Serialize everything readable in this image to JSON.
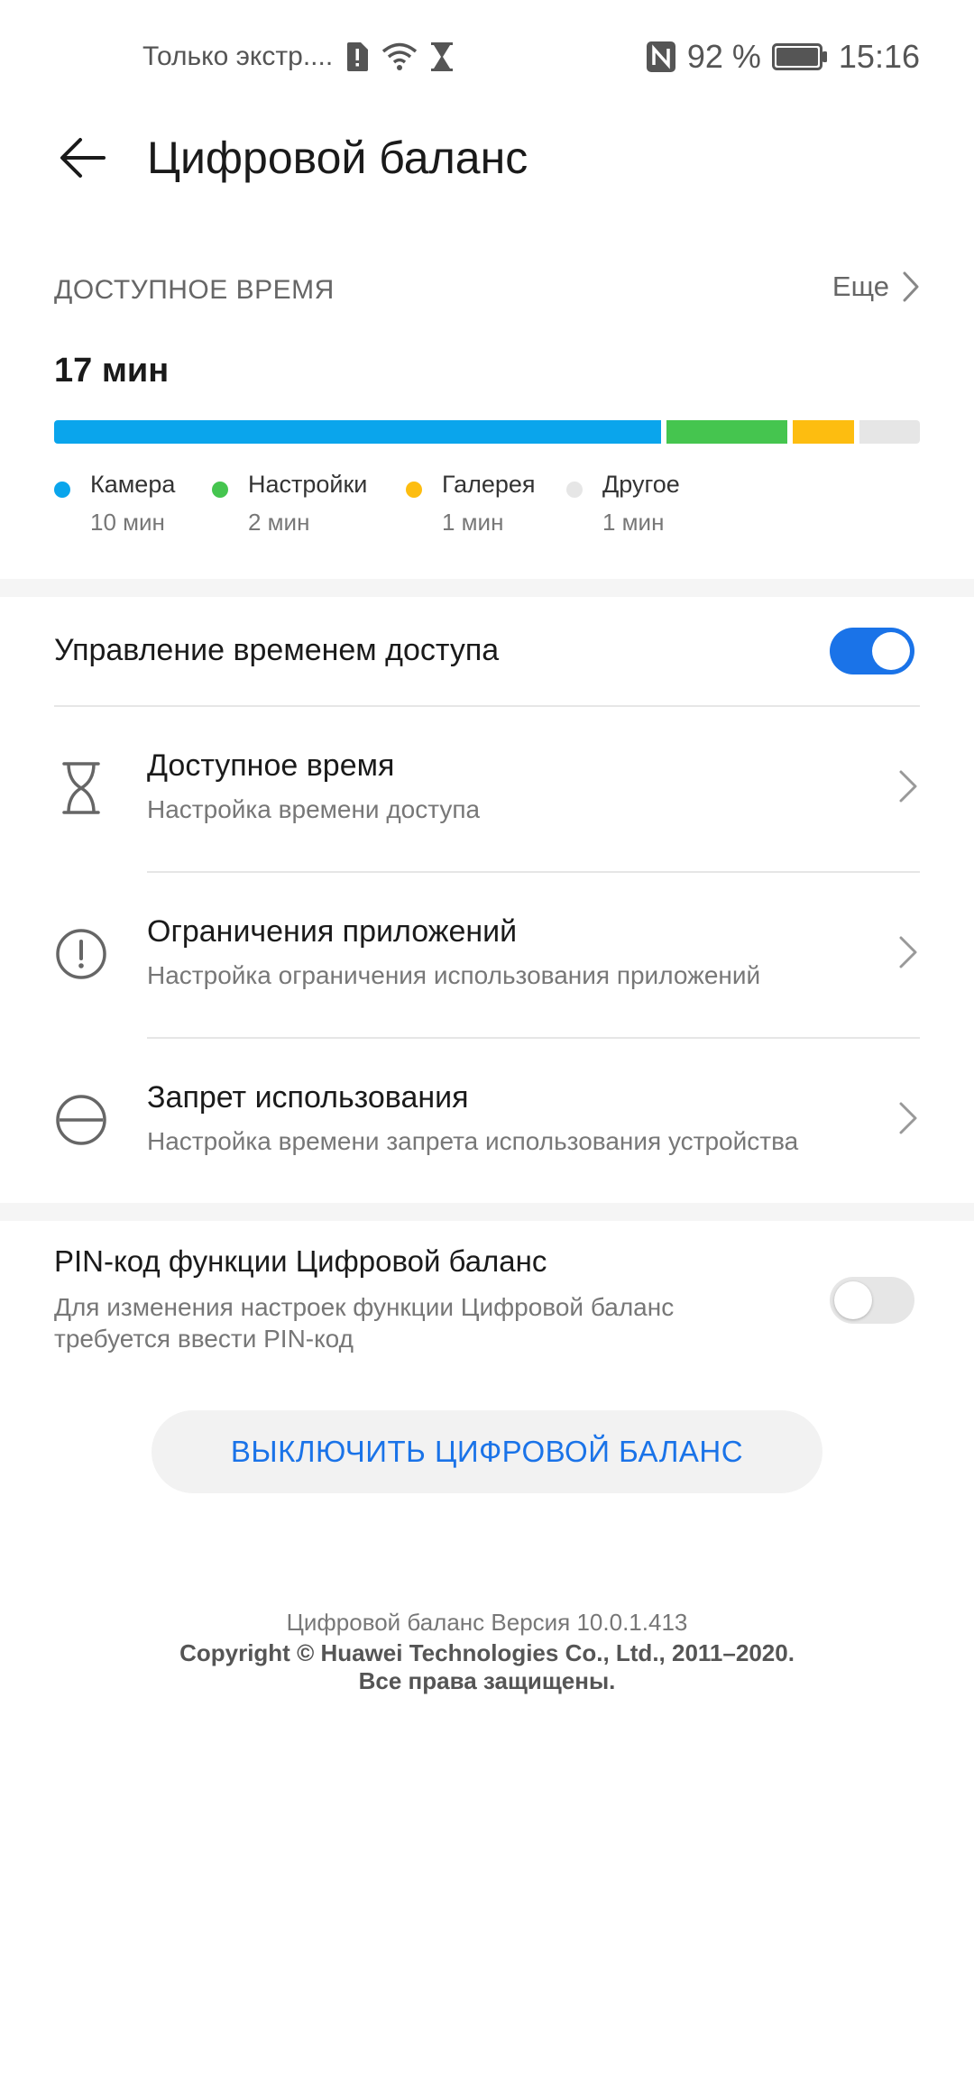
{
  "status_bar": {
    "carrier_text": "Только экстр....",
    "battery_percent": "92 %",
    "time": "15:16",
    "icons": [
      "sim-alert-icon",
      "wifi-icon",
      "hourglass-icon",
      "nfc-icon",
      "battery-icon"
    ]
  },
  "header": {
    "title": "Цифровой баланс"
  },
  "usage": {
    "section_label": "ДОСТУПНОЕ ВРЕМЯ",
    "more_label": "Еще",
    "total": "17 мин",
    "apps": [
      {
        "name": "Камера",
        "time": "10 мин",
        "minutes": 10,
        "color": "#0aa5ec"
      },
      {
        "name": "Настройки",
        "time": "2 мин",
        "minutes": 2,
        "color": "#45c54f"
      },
      {
        "name": "Галерея",
        "time": "1 мин",
        "minutes": 1,
        "color": "#fdbd10"
      },
      {
        "name": "Другое",
        "time": "1 мин",
        "minutes": 1,
        "color": "#e6e6e6"
      }
    ]
  },
  "access_control": {
    "label": "Управление временем доступа",
    "enabled": true
  },
  "menu": [
    {
      "icon": "hourglass-icon",
      "title": "Доступное время",
      "subtitle": "Настройка времени доступа"
    },
    {
      "icon": "alert-circle-icon",
      "title": "Ограничения приложений",
      "subtitle": "Настройка ограничения использования приложений"
    },
    {
      "icon": "minus-circle-icon",
      "title": "Запрет использования",
      "subtitle": "Настройка времени запрета использования устройства"
    }
  ],
  "pin": {
    "title": "PIN-код функции Цифровой баланс",
    "subtitle": "Для изменения настроек функции Цифровой баланс требуется ввести PIN-код",
    "enabled": false
  },
  "disable_button": {
    "label": "ВЫКЛЮЧИТЬ ЦИФРОВОЙ БАЛАНС"
  },
  "footer": {
    "version": "Цифровой баланс Версия 10.0.1.413",
    "copyright": "Copyright © Huawei Technologies Co., Ltd., 2011–2020.",
    "rights": "Все права защищены."
  },
  "colors": {
    "accent": "#1a73e8",
    "toggle_on": "#1a73e8",
    "toggle_off": "#e6e6e6"
  }
}
